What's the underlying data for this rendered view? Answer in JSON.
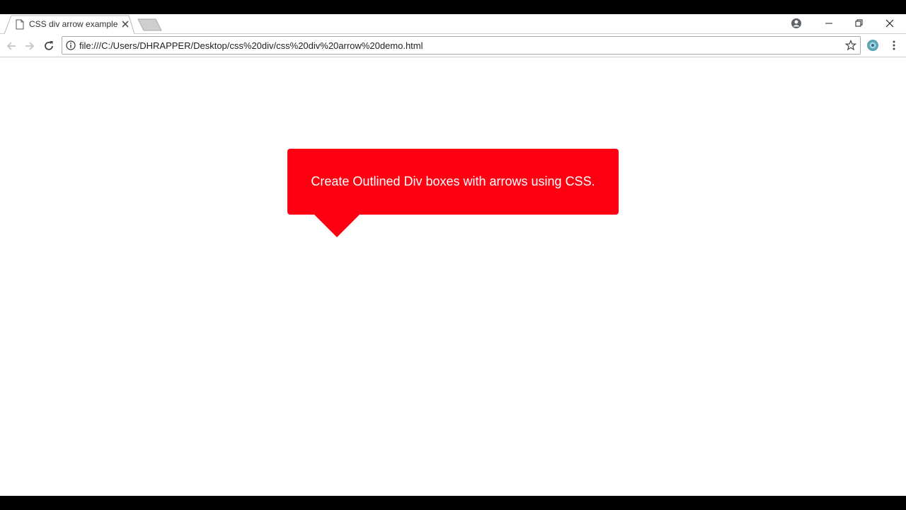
{
  "tab": {
    "title": "CSS div arrow example"
  },
  "toolbar": {
    "url": "file:///C:/Users/DHRAPPER/Desktop/css%20div/css%20div%20arrow%20demo.html"
  },
  "page": {
    "message": "Create Outlined Div boxes with arrows using CSS."
  },
  "colors": {
    "box": "#ff0013",
    "text": "#ffffff"
  },
  "icons": [
    "page-icon",
    "close-icon",
    "new-tab-icon",
    "profile-icon",
    "minimize-icon",
    "restore-icon",
    "close-window-icon",
    "back-icon",
    "forward-icon",
    "reload-icon",
    "info-icon",
    "star-icon",
    "extension-icon",
    "menu-icon"
  ]
}
